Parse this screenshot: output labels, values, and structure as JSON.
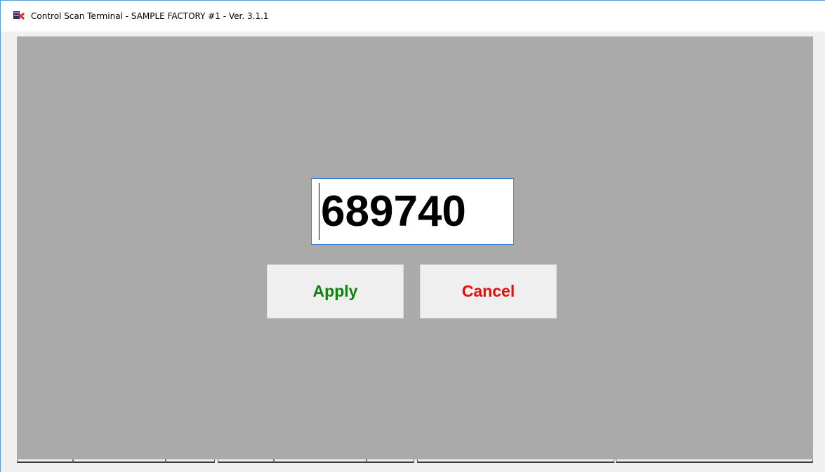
{
  "window": {
    "title": "Control Scan Terminal - SAMPLE FACTORY #1 - Ver. 3.1.1",
    "icon": "app-icon",
    "client_background": "#aaaaaa"
  },
  "input": {
    "value": "689740"
  },
  "buttons": {
    "apply_label": "Apply",
    "apply_color": "#118011",
    "cancel_label": "Cancel",
    "cancel_color": "#ee0a0a"
  },
  "statusbar": {
    "panels": [
      "",
      "",
      "",
      "",
      "",
      "",
      "",
      ""
    ]
  }
}
